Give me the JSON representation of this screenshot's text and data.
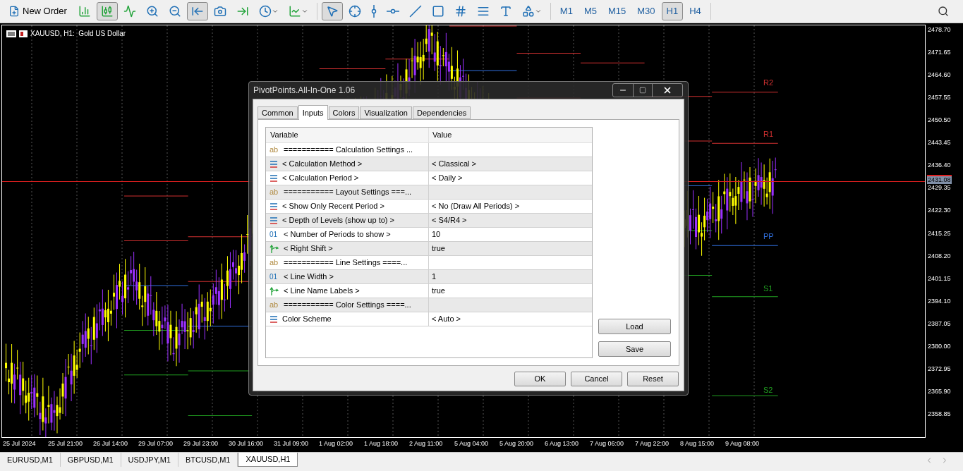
{
  "toolbar": {
    "new_order": "New Order",
    "tools": [
      {
        "kind": "bars",
        "selected": false
      },
      {
        "kind": "candles",
        "selected": true
      },
      {
        "kind": "line",
        "selected": false
      },
      {
        "kind": "zoom_in",
        "selected": false
      },
      {
        "kind": "zoom_out",
        "selected": false
      },
      {
        "kind": "autoscroll",
        "selected": true
      },
      {
        "kind": "screenshot",
        "selected": false
      },
      {
        "kind": "shift",
        "selected": false
      },
      {
        "kind": "periods",
        "selected": false
      },
      {
        "kind": "indicators",
        "selected": false
      },
      {
        "kind": "cursor",
        "selected": true
      },
      {
        "kind": "crosshair",
        "selected": false
      },
      {
        "kind": "vline",
        "selected": false
      },
      {
        "kind": "hline",
        "selected": false
      },
      {
        "kind": "trendline",
        "selected": false
      },
      {
        "kind": "rectangle",
        "selected": false
      },
      {
        "kind": "fibo",
        "selected": false
      },
      {
        "kind": "channels",
        "selected": false
      },
      {
        "kind": "text",
        "selected": false
      },
      {
        "kind": "shapes",
        "selected": false
      }
    ],
    "timeframes": [
      {
        "label": "M1",
        "selected": false
      },
      {
        "label": "M5",
        "selected": false
      },
      {
        "label": "M15",
        "selected": false
      },
      {
        "label": "M30",
        "selected": false
      },
      {
        "label": "H1",
        "selected": true
      },
      {
        "label": "H4",
        "selected": false
      }
    ]
  },
  "chart": {
    "title": "XAUUSD, H1:  Gold US Dollar",
    "prices": [
      "2478.70",
      "2471.65",
      "2464.60",
      "2457.55",
      "2450.50",
      "2443.45",
      "2436.40",
      "2429.35",
      "2422.30",
      "2415.25",
      "2408.20",
      "2401.15",
      "2394.10",
      "2387.05",
      "2380.00",
      "2372.95",
      "2365.90",
      "2358.85"
    ],
    "current_price": "2431.08",
    "times": [
      "25 Jul 2024",
      "25 Jul 21:00",
      "26 Jul 14:00",
      "29 Jul 07:00",
      "29 Jul 23:00",
      "30 Jul 16:00",
      "31 Jul 09:00",
      "1 Aug 02:00",
      "1 Aug 18:00",
      "2 Aug 11:00",
      "5 Aug 04:00",
      "5 Aug 20:00",
      "6 Aug 13:00",
      "7 Aug 06:00",
      "7 Aug 22:00",
      "8 Aug 15:00",
      "9 Aug 08:00"
    ],
    "pivot_labels": [
      {
        "label": "R2",
        "color": "#d03030"
      },
      {
        "label": "R1",
        "color": "#d03030"
      },
      {
        "label": "PP",
        "color": "#3070e0"
      },
      {
        "label": "S1",
        "color": "#20a020"
      },
      {
        "label": "S2",
        "color": "#20a020"
      }
    ]
  },
  "dialog": {
    "title": "PivotPoints.All-In-One 1.06",
    "tabs": [
      {
        "label": "Common",
        "selected": false
      },
      {
        "label": "Inputs",
        "selected": true
      },
      {
        "label": "Colors",
        "selected": false
      },
      {
        "label": "Visualization",
        "selected": false
      },
      {
        "label": "Dependencies",
        "selected": false
      }
    ],
    "columns": [
      "Variable",
      "Value"
    ],
    "rows": [
      {
        "kind": "string",
        "type_mark": "ab",
        "variable": "=========== Calculation Settings ..."
      },
      {
        "kind": "enum",
        "variable": "< Calculation Method >",
        "value": "< Classical >"
      },
      {
        "kind": "enum",
        "variable": "< Calculation Period >",
        "value": "< Daily >"
      },
      {
        "kind": "string",
        "type_mark": "ab",
        "variable": "=========== Layout Settings ===..."
      },
      {
        "kind": "enum",
        "variable": "< Show Only Recent Period >",
        "value": "< No (Draw All Periods) >"
      },
      {
        "kind": "enum",
        "variable": "< Depth of Levels (show up to) >",
        "value": "< S4/R4 >"
      },
      {
        "kind": "int",
        "type_mark": "01",
        "variable": "< Number of Periods to show >",
        "value": "10"
      },
      {
        "kind": "bool",
        "variable": "< Right Shift >",
        "value": "true"
      },
      {
        "kind": "string",
        "type_mark": "ab",
        "variable": "=========== Line Settings ====..."
      },
      {
        "kind": "int",
        "type_mark": "01",
        "variable": "< Line Width >",
        "value": "1"
      },
      {
        "kind": "bool",
        "variable": "< Line Name Labels >",
        "value": "true"
      },
      {
        "kind": "string",
        "type_mark": "ab",
        "variable": "=========== Color Settings ====..."
      },
      {
        "kind": "enum",
        "variable": "Color Scheme",
        "value": "< Auto >"
      }
    ],
    "side_buttons": [
      "Load",
      "Save"
    ],
    "buttons": [
      "OK",
      "Cancel",
      "Reset"
    ]
  },
  "symbol_tabs": [
    {
      "label": "EURUSD,M1",
      "selected": false
    },
    {
      "label": "GBPUSD,M1",
      "selected": false
    },
    {
      "label": "USDJPY,M1",
      "selected": false
    },
    {
      "label": "BTCUSD,M1",
      "selected": false
    },
    {
      "label": "XAUUSD,H1",
      "selected": true
    }
  ]
}
